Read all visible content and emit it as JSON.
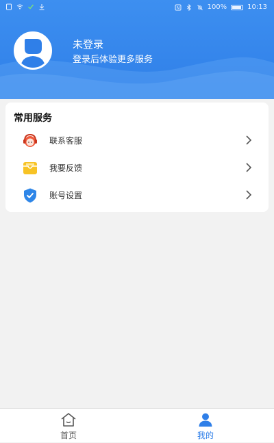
{
  "status_bar": {
    "battery_text": "100%",
    "time": "10:13"
  },
  "profile": {
    "name": "未登录",
    "subtitle": "登录后体验更多服务"
  },
  "services": {
    "title": "常用服务",
    "items": [
      {
        "label": "联系客服",
        "icon": "customer-service-icon"
      },
      {
        "label": "我要反馈",
        "icon": "feedback-icon"
      },
      {
        "label": "账号设置",
        "icon": "account-settings-icon"
      }
    ]
  },
  "bottom_nav": {
    "items": [
      {
        "label": "首页",
        "icon": "home-icon",
        "active": false
      },
      {
        "label": "我的",
        "icon": "user-icon",
        "active": true
      }
    ]
  },
  "colors": {
    "primary": "#2f7fe8",
    "header_bg": "#3d8ff0",
    "page_bg": "#f2f2f2",
    "feedback_icon": "#f7c325",
    "settings_icon": "#2e86e8",
    "service_icon": "#f05a3c"
  }
}
